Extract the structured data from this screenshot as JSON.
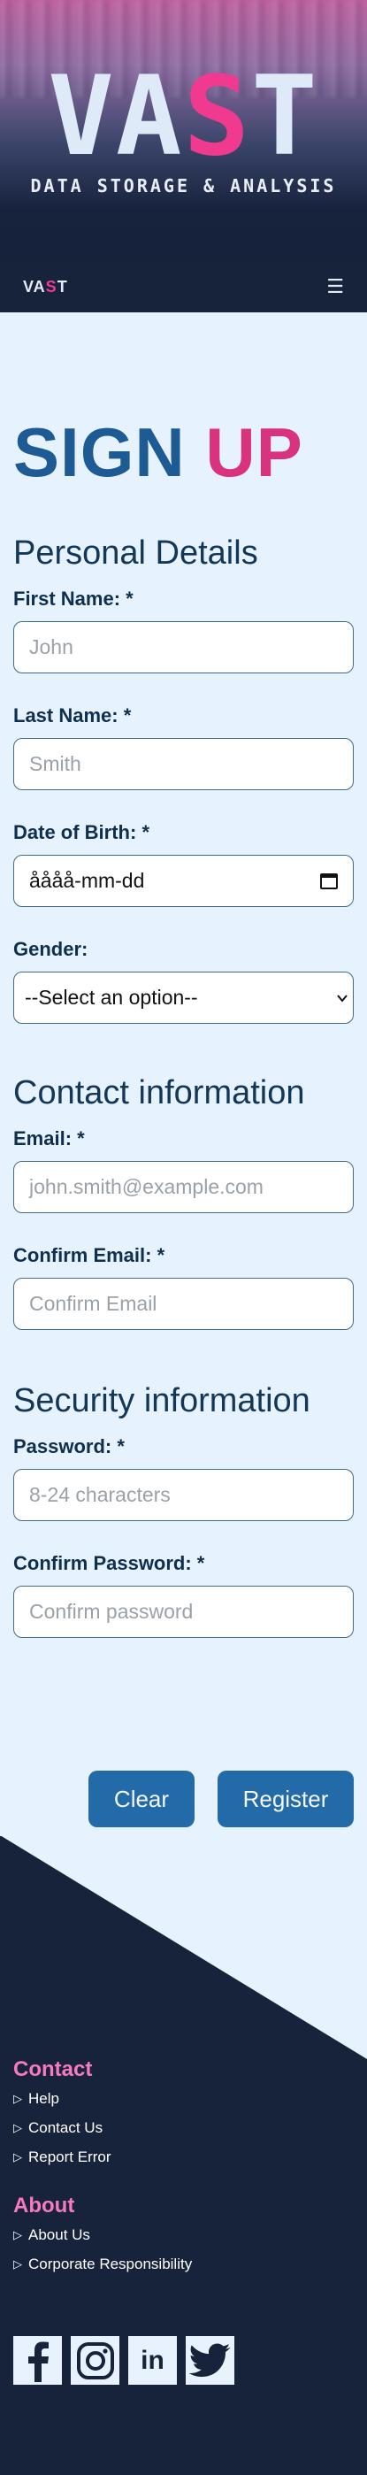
{
  "hero": {
    "brand_pre": "VA",
    "brand_pink": "S",
    "brand_post": "T",
    "tagline": "DATA STORAGE & ANALYSIS"
  },
  "navbar": {
    "logo_pre": "VA",
    "logo_pink": "S",
    "logo_post": "T",
    "menu_icon": "hamburger-icon",
    "menu_glyph": "☰"
  },
  "page": {
    "title_part1": "SIGN",
    "title_part2": "UP"
  },
  "personal": {
    "heading": "Personal Details",
    "first_name": {
      "label": "First Name: *",
      "placeholder": "John"
    },
    "last_name": {
      "label": "Last Name: *",
      "placeholder": "Smith"
    },
    "dob": {
      "label": "Date of Birth: *",
      "value": "åååå-mm-dd",
      "icon": "calendar-icon"
    },
    "gender": {
      "label": "Gender:",
      "selected": "--Select an option--",
      "icon": "chevron-down-icon"
    }
  },
  "contact": {
    "heading": "Contact information",
    "email": {
      "label": "Email: *",
      "placeholder": "john.smith@example.com"
    },
    "confirm_email": {
      "label": "Confirm Email: *",
      "placeholder": "Confirm Email"
    }
  },
  "security": {
    "heading": "Security information",
    "password": {
      "label": "Password: *",
      "placeholder": "8-24 characters"
    },
    "confirm_password": {
      "label": "Confirm Password: *",
      "placeholder": "Confirm password"
    }
  },
  "buttons": {
    "clear": "Clear",
    "register": "Register"
  },
  "footer": {
    "contact_heading": "Contact",
    "contact_links": [
      "Help",
      "Contact Us",
      "Report Error"
    ],
    "about_heading": "About",
    "about_links": [
      "About Us",
      "Corporate Responsibility"
    ],
    "link_glyph": "▷",
    "social": {
      "facebook_icon": "facebook-icon",
      "instagram_icon": "instagram-icon",
      "linkedin_icon": "linkedin-icon",
      "linkedin_text": "in",
      "twitter_icon": "twitter-icon"
    }
  },
  "colors": {
    "background": "#e6f2fd",
    "navy": "#17233b",
    "accent_blue": "#236aa8",
    "accent_pink": "#d9327f",
    "footer_heading_pink": "#f57bbd"
  }
}
